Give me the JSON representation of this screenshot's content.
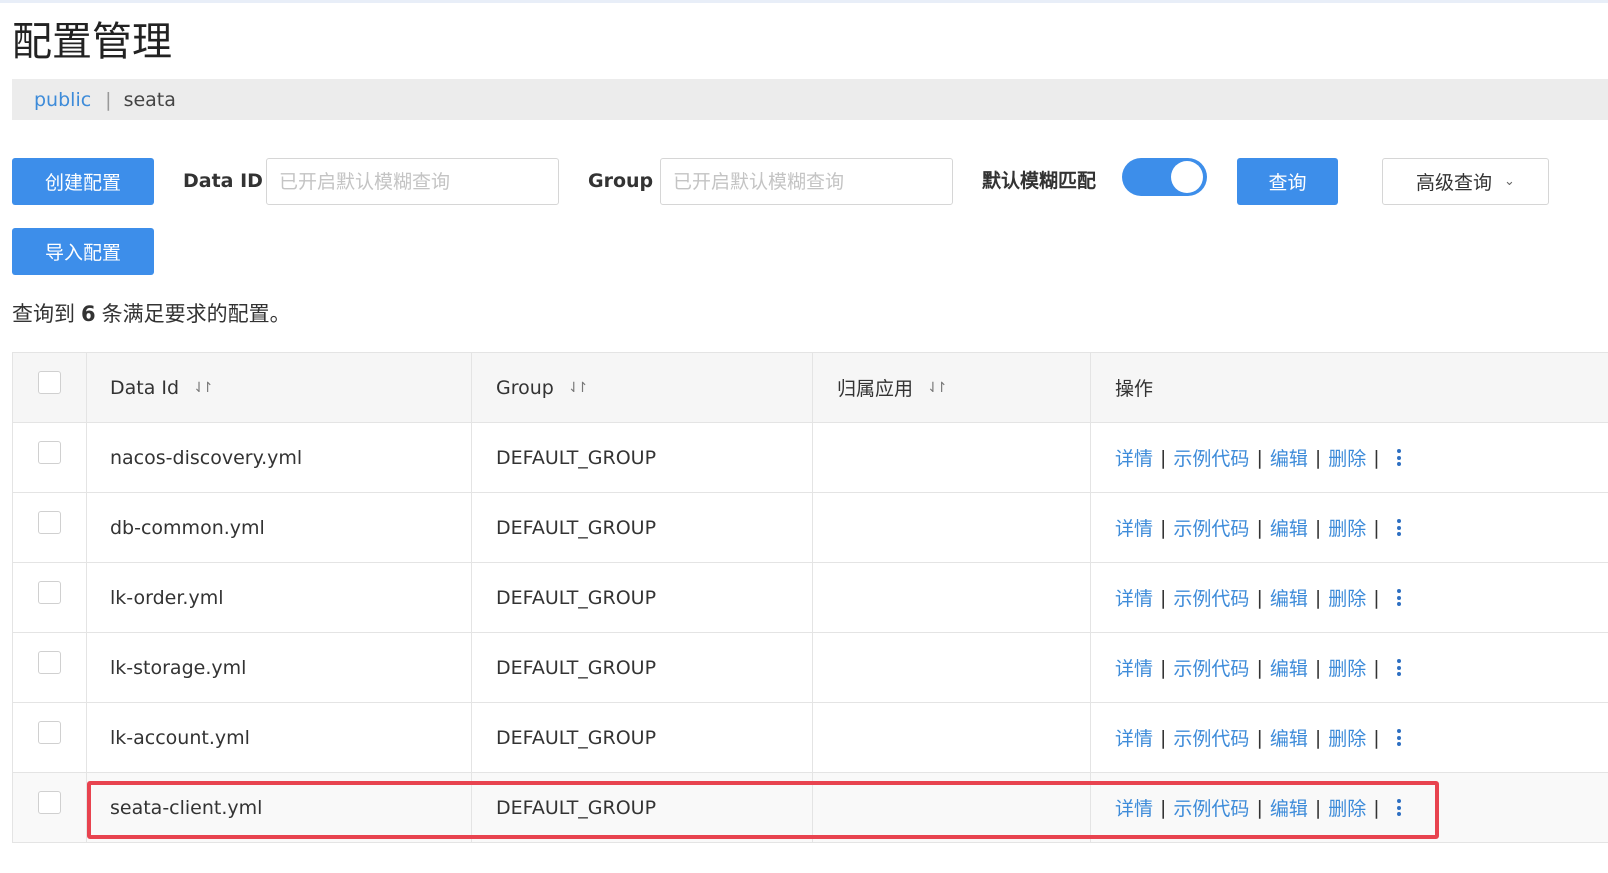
{
  "page": {
    "title": "配置管理"
  },
  "breadcrumb": {
    "namespace": "public",
    "separator": "|",
    "current": "seata"
  },
  "toolbar": {
    "create_label": "创建配置",
    "import_label": "导入配置",
    "data_id_label": "Data ID",
    "data_id_placeholder": "已开启默认模糊查询",
    "data_id_value": "",
    "group_label": "Group",
    "group_placeholder": "已开启默认模糊查询",
    "group_value": "",
    "fuzzy_label": "默认模糊匹配",
    "fuzzy_enabled": true,
    "search_label": "查询",
    "advanced_label": "高级查询",
    "advanced_icon": "chevron-down-icon"
  },
  "summary": {
    "prefix": "查询到",
    "count": "6",
    "suffix": "条满足要求的配置。"
  },
  "table": {
    "headers": {
      "data_id": "Data Id",
      "group": "Group",
      "app": "归属应用",
      "ops": "操作"
    },
    "sort_icon": "⇃↾",
    "ops": {
      "detail": "详情",
      "sample": "示例代码",
      "edit": "编辑",
      "delete": "删除",
      "sep": "|"
    },
    "rows": [
      {
        "data_id": "nacos-discovery.yml",
        "group": "DEFAULT_GROUP",
        "app": ""
      },
      {
        "data_id": "db-common.yml",
        "group": "DEFAULT_GROUP",
        "app": ""
      },
      {
        "data_id": "lk-order.yml",
        "group": "DEFAULT_GROUP",
        "app": ""
      },
      {
        "data_id": "lk-storage.yml",
        "group": "DEFAULT_GROUP",
        "app": ""
      },
      {
        "data_id": "lk-account.yml",
        "group": "DEFAULT_GROUP",
        "app": ""
      },
      {
        "data_id": "seata-client.yml",
        "group": "DEFAULT_GROUP",
        "app": ""
      }
    ]
  },
  "colors": {
    "primary": "#3d8eea",
    "link": "#3d8bd9",
    "highlight_border": "#e8434f"
  }
}
